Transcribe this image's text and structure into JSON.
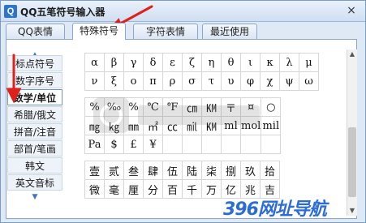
{
  "window": {
    "title": "QQ五笔符号输入器",
    "app_icon_glyph": "Q",
    "close_glyph": "×"
  },
  "tabs": [
    {
      "label": "QQ表情",
      "active": false
    },
    {
      "label": "特殊符号",
      "active": true
    },
    {
      "label": "字符表情",
      "active": false
    },
    {
      "label": "最近使用",
      "active": false
    }
  ],
  "sidebar": {
    "up_glyph": "▲",
    "down_glyph": "▼",
    "items": [
      {
        "label": "标点符号",
        "active": false
      },
      {
        "label": "数字序号",
        "active": false
      },
      {
        "label": "数学/单位",
        "active": true
      },
      {
        "label": "希腊/俄文",
        "active": false
      },
      {
        "label": "拼音/注音",
        "active": false
      },
      {
        "label": "部首/笔画",
        "active": false
      },
      {
        "label": "韩文",
        "active": false
      },
      {
        "label": "英文音标",
        "active": false
      }
    ]
  },
  "greek_rows": [
    [
      "α",
      "β",
      "γ",
      "δ",
      "ε",
      "ζ",
      "η",
      "θ",
      "ι",
      "κ",
      "λ",
      "μ"
    ],
    [
      "ν",
      "ξ",
      "ο",
      "π",
      "ρ",
      "σ",
      "τ",
      "υ",
      "φ",
      "χ",
      "ψ",
      "ω"
    ]
  ],
  "unit_rows": [
    [
      "%",
      "‰",
      "%",
      "℃",
      "℉",
      "㎝",
      "㏎",
      "〒",
      "¤",
      "○"
    ],
    [
      "㎎",
      "㎏",
      "㎜",
      "㎡",
      "㏄",
      "㏕",
      "㏎",
      "ml",
      "mol",
      "mil"
    ],
    [
      "Pa",
      "$",
      "£",
      "¥",
      "",
      "",
      "",
      "",
      "",
      ""
    ]
  ],
  "numeral_rows": [
    [
      "壹",
      "贰",
      "叁",
      "肆",
      "伍",
      "陆",
      "柒",
      "捌",
      "玖",
      "拾"
    ],
    [
      "微",
      "毫",
      "厘",
      "分",
      "百",
      "千",
      "万",
      "亿",
      "兆",
      "吉"
    ]
  ],
  "scrollbar": {
    "up_glyph": "▲",
    "down_glyph": "▼"
  },
  "watermark": {
    "text": "396网址导航"
  },
  "colors": {
    "accent": "#3c77c2",
    "annotation_arrow": "#e0201a",
    "window_bg": "#dfe9f6"
  }
}
